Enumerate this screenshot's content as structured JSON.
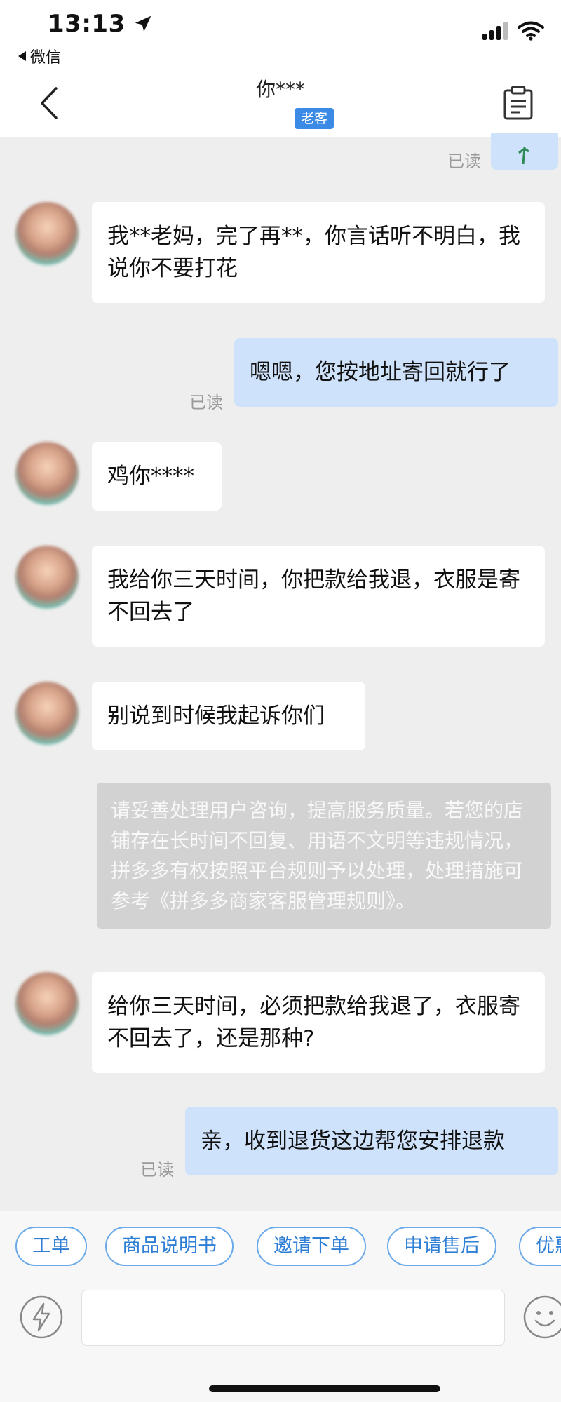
{
  "status": {
    "time": "13:13",
    "back_app": "微信"
  },
  "nav": {
    "title": "你***",
    "badge": "老客"
  },
  "chat": {
    "read_label": "已读",
    "messages": [
      {
        "from": "customer",
        "text": "我**老妈，完了再**，你言话听不明白，我说你不要打花"
      },
      {
        "from": "me",
        "text": "嗯嗯，您按地址寄回就行了"
      },
      {
        "from": "customer",
        "text": "鸡你****"
      },
      {
        "from": "customer",
        "text": "我给你三天时间，你把款给我退，衣服是寄不回去了"
      },
      {
        "from": "customer",
        "text": "别说到时候我起诉你们"
      },
      {
        "from": "customer",
        "text": "给你三天时间，必须把款给我退了，衣服寄不回去了，还是那种?"
      },
      {
        "from": "me",
        "text": "亲，收到退货这边帮您安排退款"
      }
    ],
    "system_notice": "请妥善处理用户咨询，提高服务质量。若您的店铺存在长时间不回复、用语不文明等违规情况，拼多多有权按照平台规则予以处理，处理措施可参考《拼多多商家客服管理规则》。"
  },
  "quick_replies": [
    "工单",
    "商品说明书",
    "邀请下单",
    "申请售后",
    "优惠"
  ],
  "input": {
    "placeholder": ""
  },
  "colors": {
    "accent": "#3b8be6",
    "my_bubble": "#cfe2fb",
    "background": "#eeeeee"
  },
  "icons": {
    "location_arrow": "location-arrow-icon",
    "signal": "signal-icon",
    "wifi": "wifi-icon",
    "back": "chevron-left-icon",
    "clipboard": "clipboard-icon",
    "bolt": "bolt-icon",
    "emoji": "emoji-icon"
  }
}
